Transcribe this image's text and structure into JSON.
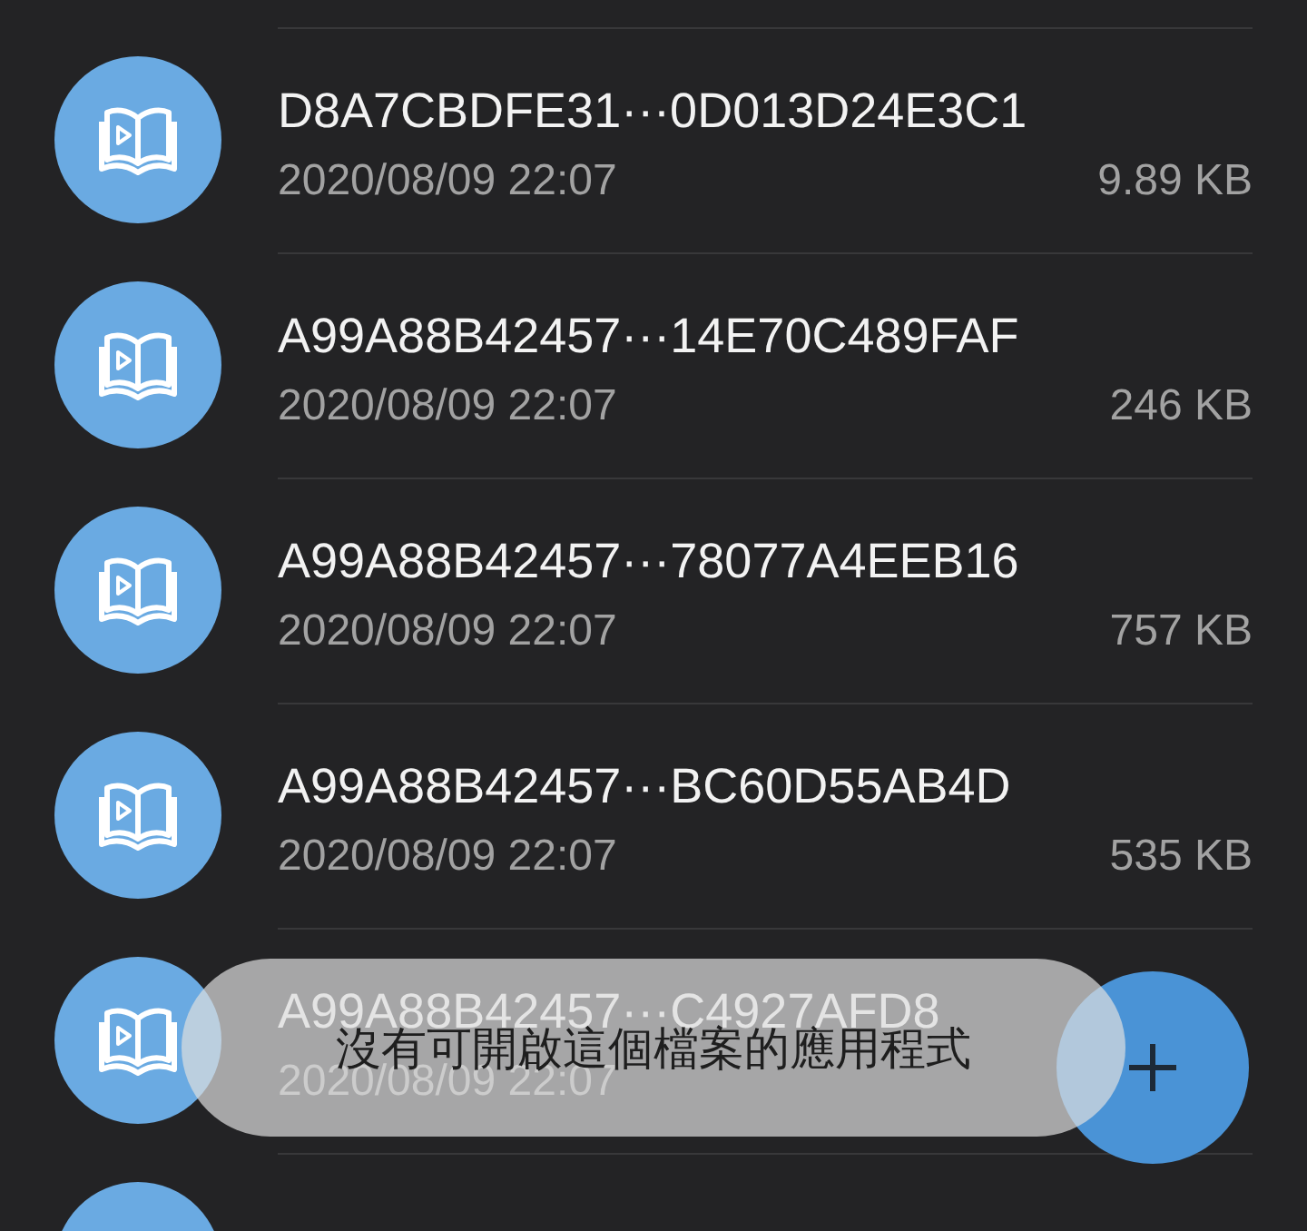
{
  "files": [
    {
      "kind": "file",
      "name": "D8A7CBDFE31···0D013D24E3C1",
      "date": "2020/08/09 22:07",
      "size": "9.89 KB"
    },
    {
      "kind": "file",
      "name": "A99A88B42457···14E70C489FAF",
      "date": "2020/08/09 22:07",
      "size": "246 KB"
    },
    {
      "kind": "file",
      "name": "A99A88B42457···78077A4EEB16",
      "date": "2020/08/09 22:07",
      "size": "757 KB"
    },
    {
      "kind": "file",
      "name": "A99A88B42457···BC60D55AB4D",
      "date": "2020/08/09 22:07",
      "size": "535 KB"
    },
    {
      "kind": "file",
      "name": "A99A88B42457···C4927AFD8",
      "date": "2020/08/09 22:07"
    },
    {
      "kind": "cut"
    }
  ],
  "toast": {
    "message": "沒有可開啟這個檔案的應用程式"
  }
}
